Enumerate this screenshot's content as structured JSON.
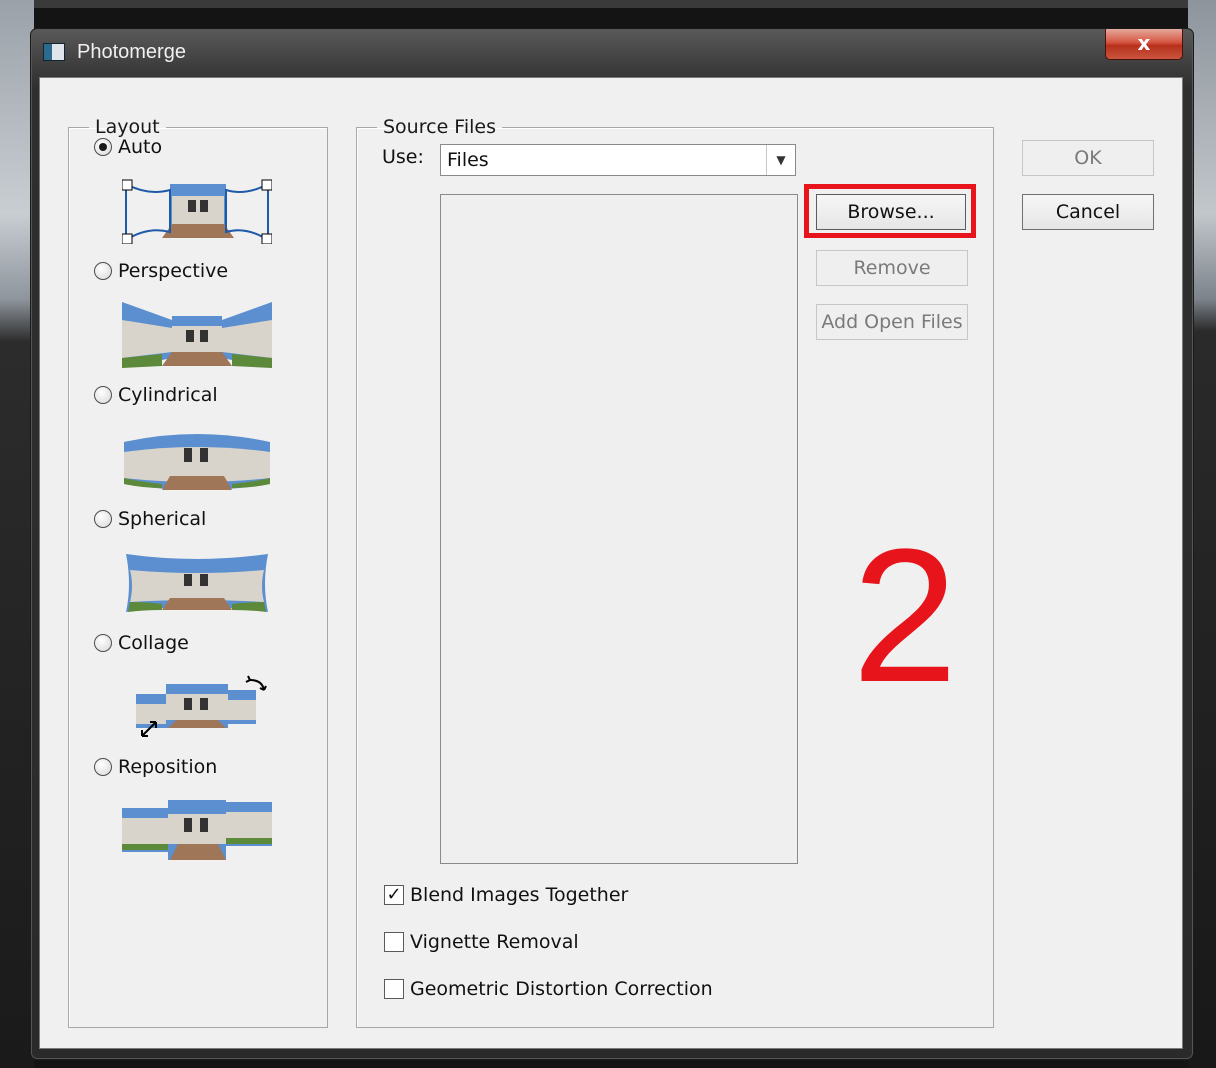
{
  "window": {
    "title": "Photomerge",
    "close_glyph": "x"
  },
  "layout": {
    "legend": "Layout",
    "options": [
      {
        "label": "Auto",
        "selected": true,
        "thumbnail": "auto-layout-preview"
      },
      {
        "label": "Perspective",
        "selected": false,
        "thumbnail": "perspective-layout-preview"
      },
      {
        "label": "Cylindrical",
        "selected": false,
        "thumbnail": "cylindrical-layout-preview"
      },
      {
        "label": "Spherical",
        "selected": false,
        "thumbnail": "spherical-layout-preview"
      },
      {
        "label": "Collage",
        "selected": false,
        "thumbnail": "collage-layout-preview"
      },
      {
        "label": "Reposition",
        "selected": false,
        "thumbnail": "reposition-layout-preview"
      }
    ]
  },
  "source": {
    "legend": "Source Files",
    "use_label": "Use:",
    "use_value": "Files",
    "buttons": {
      "browse": "Browse...",
      "remove": "Remove",
      "add_open_files": "Add Open Files"
    },
    "checkboxes": [
      {
        "label": "Blend Images Together",
        "checked": true
      },
      {
        "label": "Vignette Removal",
        "checked": false
      },
      {
        "label": "Geometric Distortion Correction",
        "checked": false
      }
    ]
  },
  "dialog_buttons": {
    "ok": "OK",
    "cancel": "Cancel"
  },
  "annotation": {
    "step_number": "2",
    "color": "#e8141b"
  },
  "colors": {
    "dialog_bg": "#f0f0f0",
    "sky": "#5b8fd0",
    "building": "#d9d4cb",
    "ground": "#a07658",
    "grass": "#5c8a3a"
  }
}
